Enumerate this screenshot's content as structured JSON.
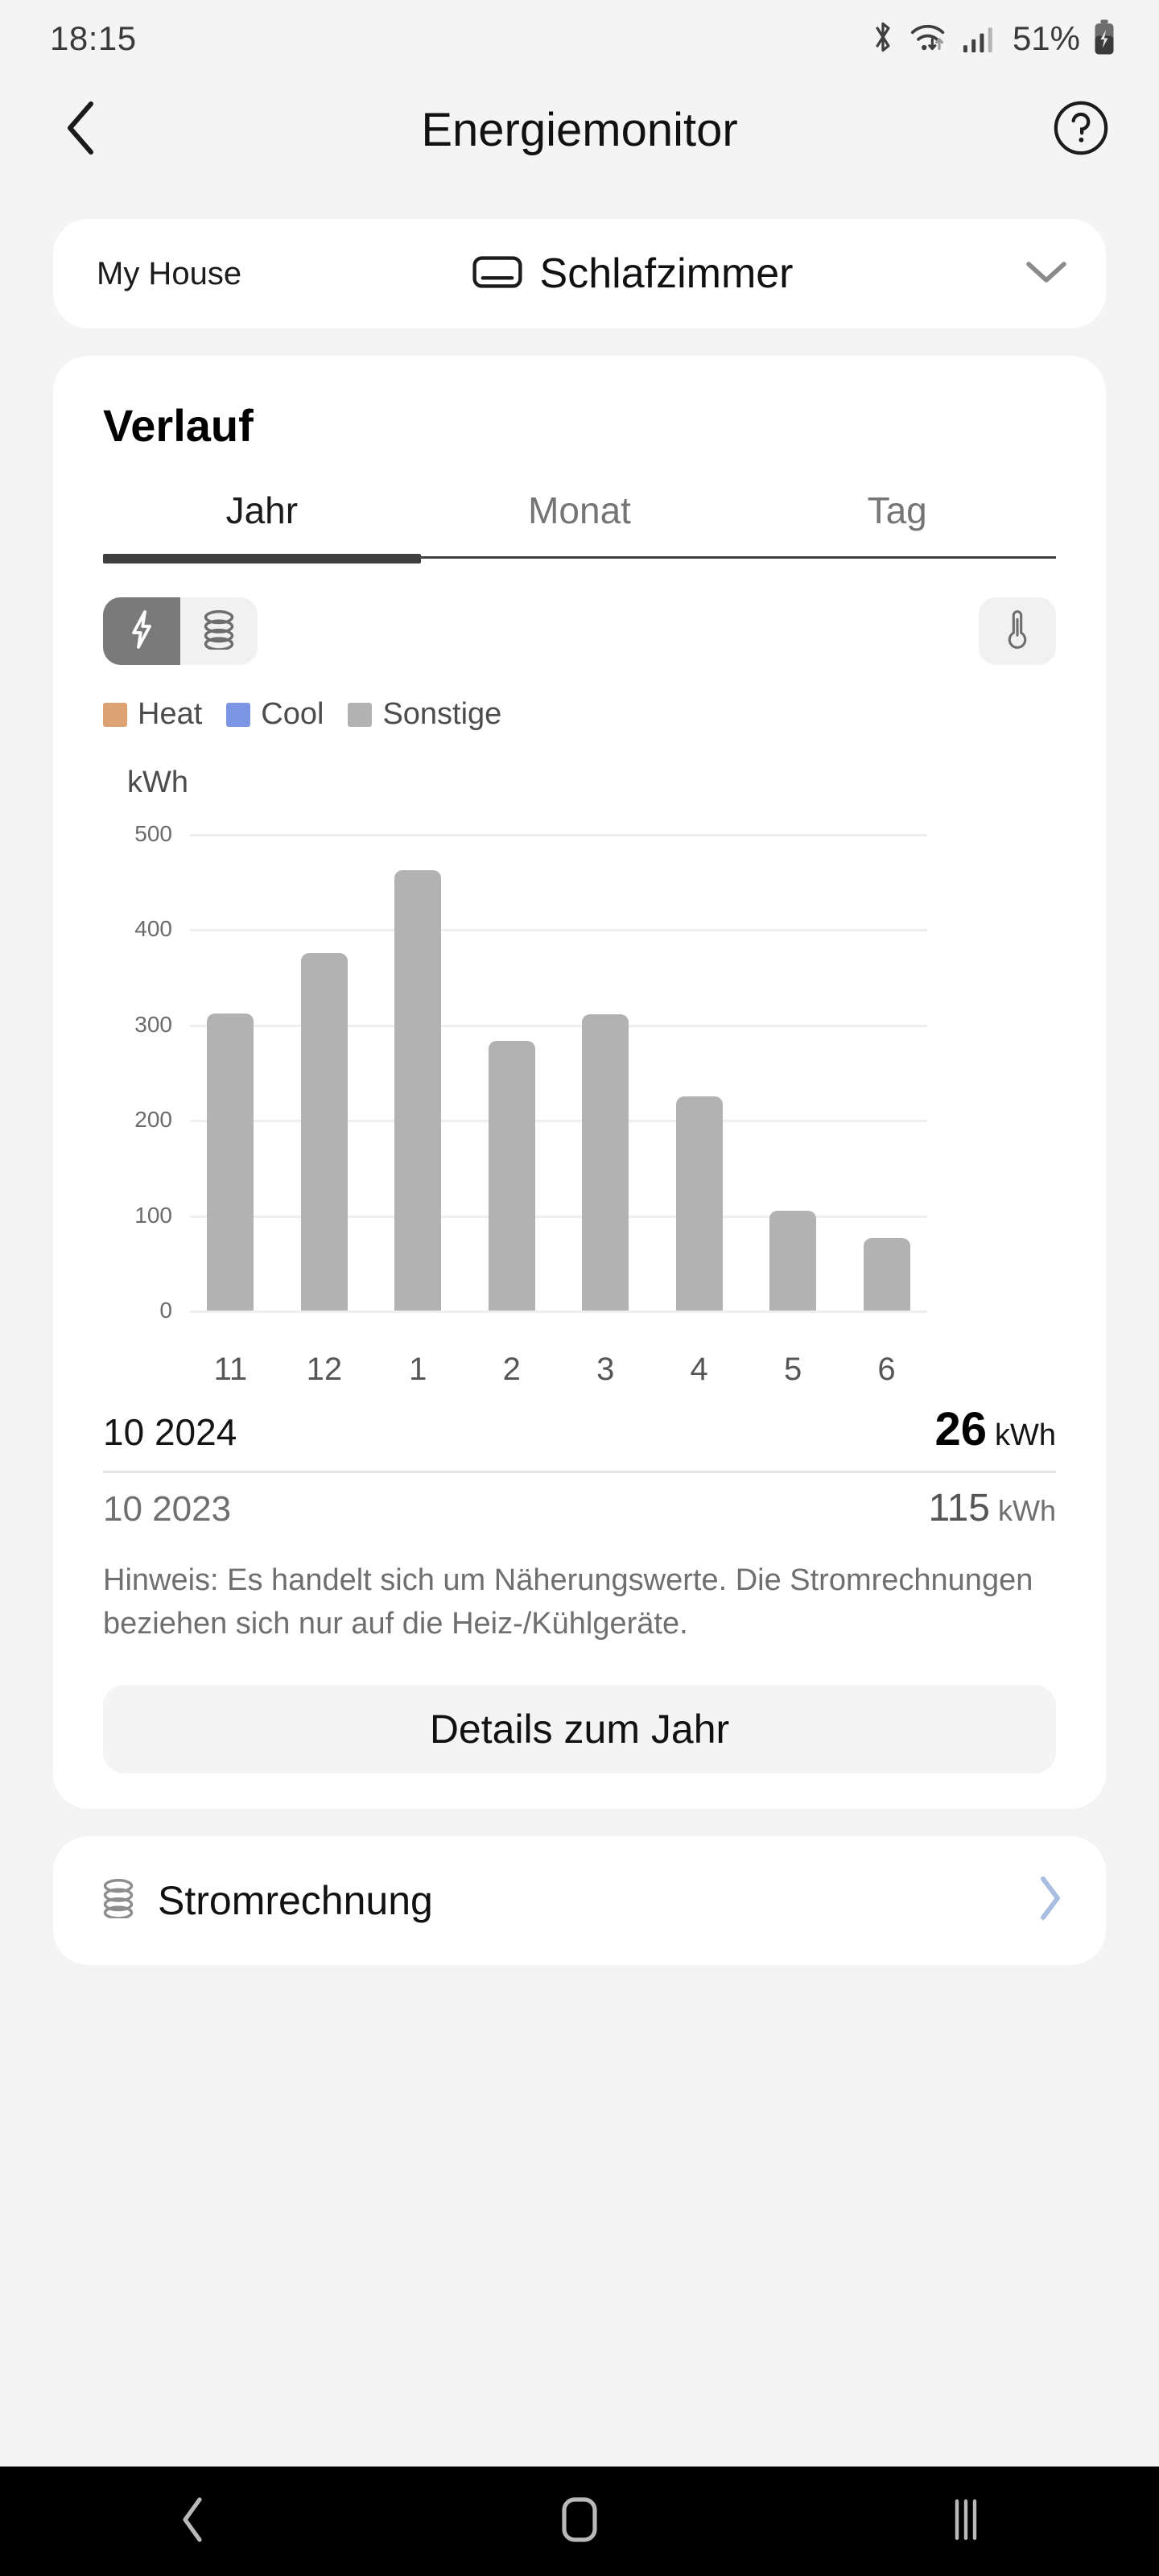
{
  "status_bar": {
    "time": "18:15",
    "battery_percent": "51%",
    "icons": [
      "bluetooth-icon",
      "wifi-icon",
      "cellular-signal-icon",
      "battery-charging-icon"
    ]
  },
  "header": {
    "back_icon": "chevron-left-icon",
    "title": "Energiemonitor",
    "help_icon": "help-circle-icon"
  },
  "room_selector": {
    "house": "My House",
    "device_icon": "air-conditioner-icon",
    "room": "Schlafzimmer",
    "chevron": "chevron-down-icon"
  },
  "history_card": {
    "title": "Verlauf",
    "tabs": [
      {
        "label": "Jahr",
        "active": true
      },
      {
        "label": "Monat",
        "active": false
      },
      {
        "label": "Tag",
        "active": false
      }
    ],
    "mode_toggle": [
      {
        "icon": "lightning-bolt-icon",
        "active": true
      },
      {
        "icon": "coins-stack-icon",
        "active": false
      }
    ],
    "temperature_button_icon": "thermometer-icon",
    "legend": [
      {
        "label": "Heat",
        "color": "#dea172"
      },
      {
        "label": "Cool",
        "color": "#7b96e3"
      },
      {
        "label": "Sonstige",
        "color": "#b2b2b2"
      }
    ],
    "summary": {
      "current_period": "10 2024",
      "current_value": "26",
      "current_unit": "kWh",
      "previous_period": "10 2023",
      "previous_value": "115",
      "previous_unit": "kWh"
    },
    "hint": "Hinweis: Es handelt sich um Näherungswerte. Die Stromrechnungen beziehen sich nur auf die Heiz-/Kühlgeräte.",
    "details_button": "Details zum Jahr"
  },
  "bill_card": {
    "icon": "coins-stack-icon",
    "label": "Stromrechnung",
    "chevron": "chevron-right-icon",
    "chevron_color": "#a8bde0"
  },
  "nav_bar": {
    "back_icon": "nav-back-icon",
    "home_icon": "nav-home-icon",
    "recents_icon": "nav-recents-icon"
  },
  "chart_data": {
    "type": "bar",
    "title": "",
    "ylabel": "kWh",
    "xlabel": "",
    "categories": [
      "11",
      "12",
      "1",
      "2",
      "3",
      "4",
      "5",
      "6"
    ],
    "values": [
      312,
      375,
      462,
      283,
      311,
      225,
      105,
      76
    ],
    "series": [
      {
        "name": "Sonstige",
        "color": "#b2b2b2",
        "values": [
          312,
          375,
          462,
          283,
          311,
          225,
          105,
          76
        ]
      }
    ],
    "ylim": [
      0,
      500
    ],
    "yticks": [
      500,
      400,
      300,
      200,
      100,
      0
    ],
    "grid": true,
    "legend_position": "top-left",
    "bar_color": "#b2b2b2"
  }
}
